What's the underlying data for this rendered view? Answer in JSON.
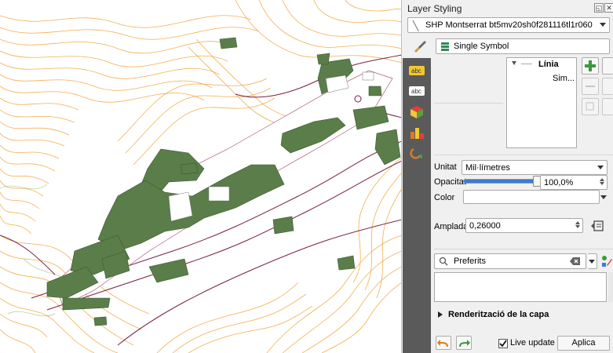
{
  "panel": {
    "title": "Layer Styling",
    "layer_name": "SHP Montserrat bt5mv20sh0f281116tl1r060",
    "renderer": "Single Symbol"
  },
  "symbol_tree": {
    "root_label": "Línia",
    "child_label": "Sim..."
  },
  "props": {
    "unit_label": "Unitat",
    "unit_value": "Mil·límetres",
    "opacity_label": "Opacitat",
    "opacity_value": "100,0%",
    "opacity_fraction": 1.0,
    "color_label": "Color",
    "color_value": "#ffffff",
    "width_label": "Amplada",
    "width_value": "0,26000"
  },
  "favorites": {
    "placeholder": "Preferits"
  },
  "render_section": {
    "label": "Renderització de la capa"
  },
  "footer": {
    "live_update_label": "Live update",
    "live_update_checked": true,
    "apply_label": "Aplica"
  },
  "colors": {
    "contour": "#f0a030",
    "contour_light": "#f8c880",
    "building": "#5a7d4a",
    "road": "#7a2040"
  }
}
